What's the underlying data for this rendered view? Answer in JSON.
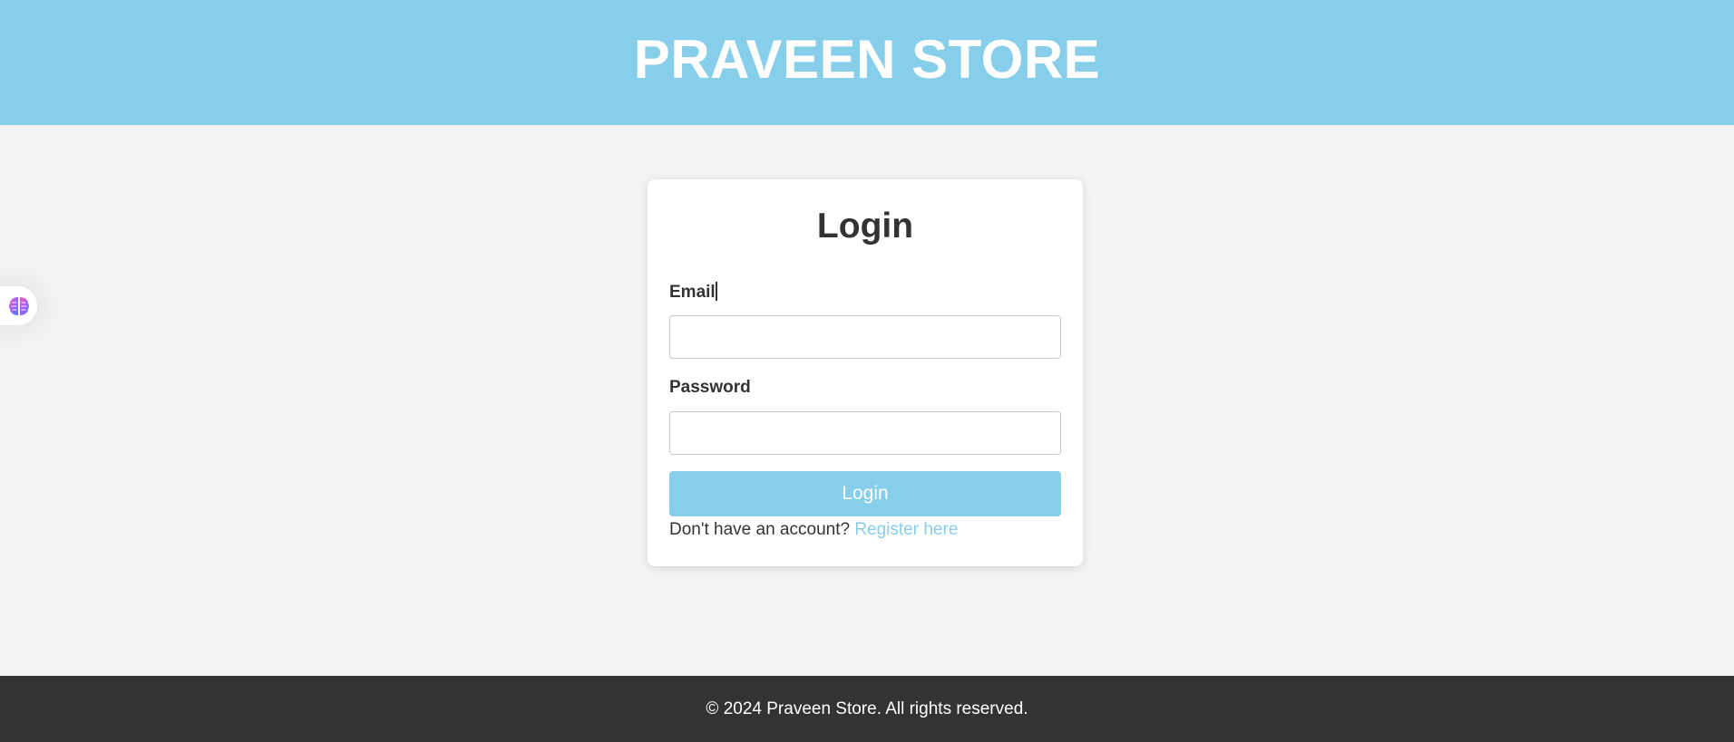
{
  "header": {
    "title": "PRAVEEN STORE"
  },
  "login_form": {
    "title": "Login",
    "email_label": "Email",
    "email_value": "",
    "password_label": "Password",
    "password_value": "",
    "submit_label": "Login",
    "register_prompt": "Don't have an account?",
    "register_link": "Register here"
  },
  "footer": {
    "text": "© 2024 Praveen Store. All rights reserved."
  },
  "widget": {
    "icon": "brain-icon"
  },
  "colors": {
    "accent": "#87ceeb",
    "background": "#f3f3f3",
    "footer": "#333333",
    "text": "#333333"
  }
}
